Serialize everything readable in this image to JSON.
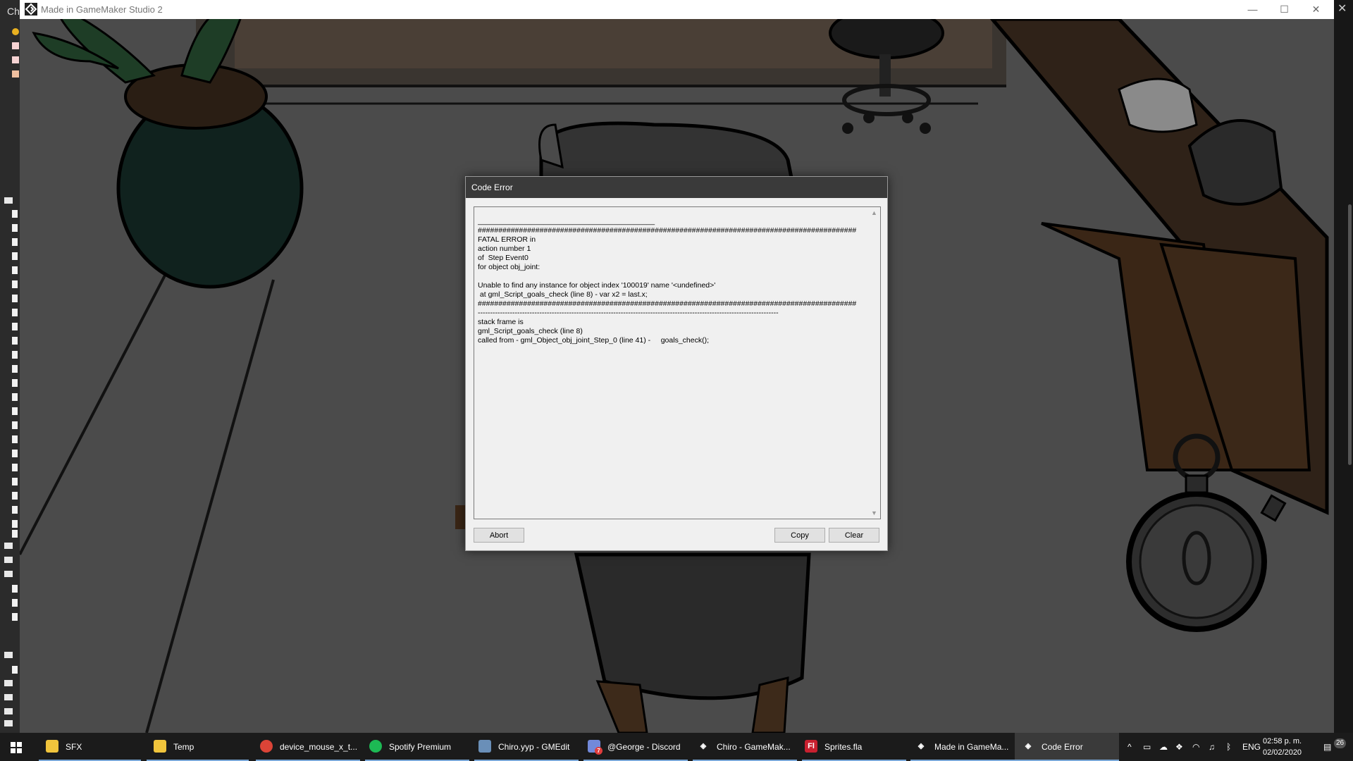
{
  "ide": {
    "label": "Ch"
  },
  "game_window": {
    "title": "Made in GameMaker Studio 2",
    "minimize": "—",
    "maximize": "☐",
    "close": "✕"
  },
  "dialog": {
    "title": "Code Error",
    "error_text": "___________________________________________\n############################################################################################\nFATAL ERROR in\naction number 1\nof  Step Event0\nfor object obj_joint:\n\nUnable to find any instance for object index '100019' name '<undefined>'\n at gml_Script_goals_check (line 8) - var x2 = last.x;\n############################################################################################\n--------------------------------------------------------------------------------------------------------------------------\nstack frame is\ngml_Script_goals_check (line 8)\ncalled from - gml_Object_obj_joint_Step_0 (line 41) -     goals_check();",
    "abort_label": "Abort",
    "copy_label": "Copy",
    "clear_label": "Clear"
  },
  "taskbar": {
    "items": [
      {
        "label": "SFX",
        "icon": "folder-icon",
        "color": "#f0c43c"
      },
      {
        "label": "Temp",
        "icon": "folder-icon",
        "color": "#f0c43c"
      },
      {
        "label": "device_mouse_x_t...",
        "icon": "chrome-icon",
        "color": "#db4437"
      },
      {
        "label": "Spotify Premium",
        "icon": "spotify-icon",
        "color": "#1db954"
      },
      {
        "label": "Chiro.yyp - GMEdit",
        "icon": "gmedit-icon",
        "color": "#6a8fb8"
      },
      {
        "label": "@George - Discord",
        "icon": "discord-icon",
        "color": "#7289da"
      },
      {
        "label": "Chiro - GameMak...",
        "icon": "gamemaker-icon",
        "color": "#ffffff"
      },
      {
        "label": "Sprites.fla",
        "icon": "flash-icon",
        "color": "#c8202f"
      },
      {
        "label": "Made in GameMa...",
        "icon": "gamemaker-icon",
        "color": "#ffffff"
      },
      {
        "label": "Code Error",
        "icon": "gamemaker-icon",
        "color": "#ffffff"
      }
    ],
    "language": "ENG",
    "time": "02:58 p. m.",
    "date": "02/02/2020",
    "notification_count": "26",
    "discord_badge": "7"
  }
}
